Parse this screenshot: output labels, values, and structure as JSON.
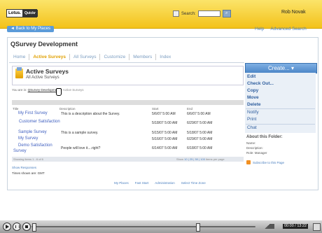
{
  "header": {
    "logo_brand": "Lotus.",
    "logo_product": "Quickr",
    "search_label": "Search:",
    "search_value": "",
    "user": "Rob Novak"
  },
  "nav": {
    "back": "◄ Back to My Places",
    "help": "Help",
    "advanced_search": "Advanced Search"
  },
  "page": {
    "title": "QSurvey Development"
  },
  "tabs": [
    "Home",
    "Active Surveys",
    "All Surveys",
    "Customize",
    "Members",
    "Index"
  ],
  "section": {
    "title": "Active Surveys",
    "subtitle": "All Active Surveys"
  },
  "breadcrumb": {
    "prefix": "You are in:",
    "parent": "QSurvey Development",
    "current": "> Active Surveys"
  },
  "table": {
    "headers": [
      "Title",
      "Description",
      "Start",
      "End"
    ],
    "rows": [
      {
        "title": "My First Survey",
        "desc": "This is a description about the Survey.",
        "start": "5/6/07 5:00 AM",
        "end": "6/6/07 5:00 AM"
      },
      {
        "title": "Customer Satisfaction",
        "desc": "",
        "start": "5/18/07 5:00 AM",
        "end": "6/29/07 5:00 AM"
      },
      {
        "title": "Sample Survey",
        "desc": "This is a sample survey.",
        "start": "5/15/07 5:00 AM",
        "end": "5/18/07 5:00 AM"
      },
      {
        "title": "My Survey",
        "desc": "",
        "start": "5/16/07 5:00 AM",
        "end": "6/29/07 5:00 AM"
      },
      {
        "title": "Demo Satisfaction Survey",
        "desc": "People will love it....right?",
        "start": "6/14/07 5:00 AM",
        "end": "6/18/07 5:00 AM"
      }
    ]
  },
  "pager": {
    "showing": "Showing items 1 - 6 of 6",
    "show_label": "Show",
    "options": "10 | 25 | 50 | 100",
    "per_page": "items per page"
  },
  "links": {
    "show_responses": "Show Responses",
    "times_shown": "Times shown are: GMT"
  },
  "footer": [
    "My Places",
    "Fast Start",
    "Administration",
    "Select Time Zone"
  ],
  "actions": {
    "create": "Create...",
    "items": [
      "Edit",
      "Check Out...",
      "Copy",
      "Move",
      "Delete",
      "Notify",
      "Print",
      "Chat"
    ]
  },
  "folder": {
    "title": "About this Folder:",
    "name": "Name:",
    "description": "Description:",
    "role": "Role: Manager",
    "subscribe": "Subscribe to this Page"
  },
  "player": {
    "time": "00:00 / 13:22"
  }
}
